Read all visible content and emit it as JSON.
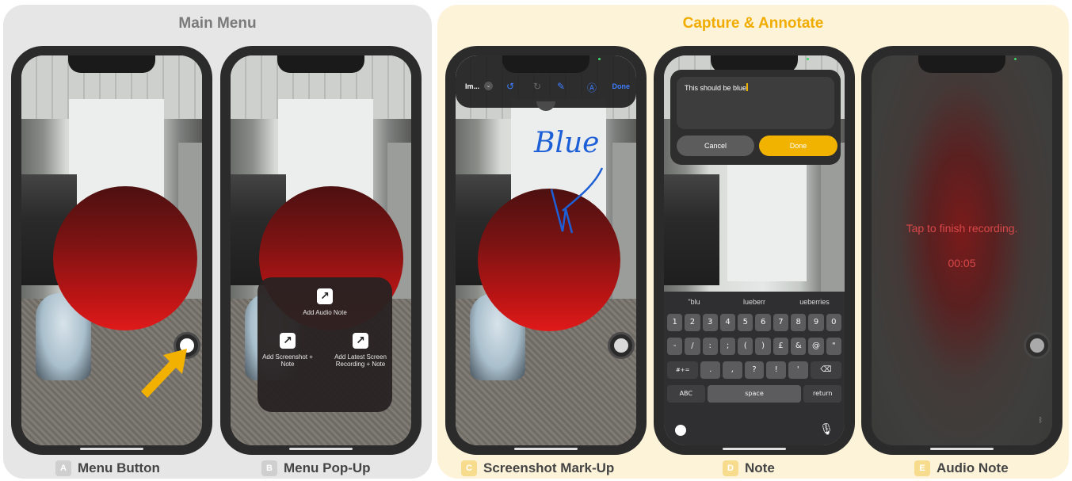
{
  "panels": {
    "main_menu": "Main Menu",
    "capture_annotate": "Capture & Annotate"
  },
  "captions": [
    {
      "letter": "A",
      "label": "Menu Button"
    },
    {
      "letter": "B",
      "label": "Menu Pop-Up"
    },
    {
      "letter": "C",
      "label": "Screenshot Mark-Up"
    },
    {
      "letter": "D",
      "label": "Note"
    },
    {
      "letter": "E",
      "label": "Audio Note"
    }
  ],
  "popup": {
    "audio": "Add Audio Note",
    "screenshot": "Add Screenshot + Note",
    "recording": "Add Latest Screen Recording + Note"
  },
  "markup": {
    "title": "Im...",
    "done": "Done",
    "handwriting": "Blue"
  },
  "note": {
    "text": "This should be blue",
    "cancel": "Cancel",
    "done": "Done",
    "suggestions": [
      "\"blu",
      "lueberr",
      "ueberries"
    ],
    "row1": [
      "1",
      "2",
      "3",
      "4",
      "5",
      "6",
      "7",
      "8",
      "9",
      "0"
    ],
    "row2": [
      "-",
      "/",
      ":",
      ";",
      "(",
      ")",
      "£",
      "&",
      "@",
      "\""
    ],
    "row3": [
      ".",
      ",",
      "?",
      "!",
      "'"
    ],
    "row3_left": "#+=",
    "abc": "ABC",
    "space": "space",
    "return": "return"
  },
  "audio": {
    "message": "Tap to finish recording.",
    "time": "00:05"
  },
  "colors": {
    "accent_yellow": "#f0ac00",
    "ios_blue": "#3e7dff",
    "record_red": "#d9484a"
  }
}
